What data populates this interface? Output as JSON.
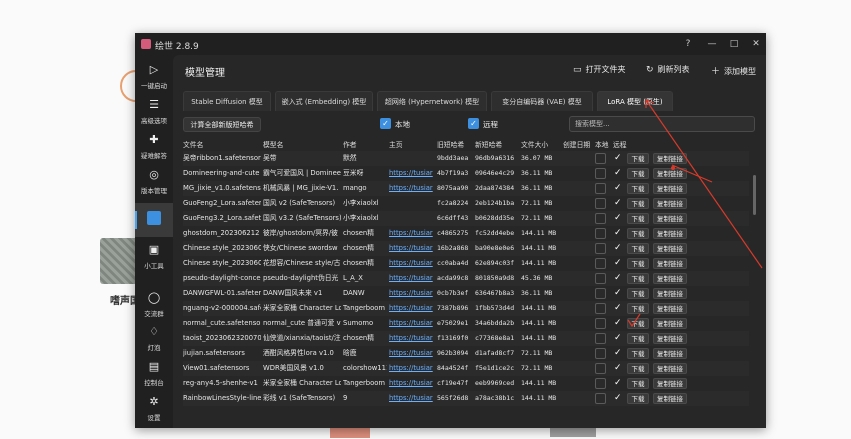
{
  "app": {
    "title": "绘世 2.8.9",
    "help": "?",
    "minimize": "—",
    "maximize": "□",
    "close": "✕"
  },
  "sidebar": [
    {
      "label": "一键启动",
      "icon": "play-icon",
      "glyph": "▷"
    },
    {
      "label": "高级选项",
      "icon": "list-icon",
      "glyph": "☰"
    },
    {
      "label": "疑难解答",
      "icon": "diagnose-icon",
      "glyph": "✚"
    },
    {
      "label": "版本管理",
      "icon": "version-icon",
      "glyph": "◎"
    },
    {
      "label": "",
      "icon": "model-cube-icon",
      "glyph": ""
    },
    {
      "label": "小工具",
      "icon": "toolbox-icon",
      "glyph": "▣"
    },
    {
      "label": "交流群",
      "icon": "chat-icon",
      "glyph": "◯"
    },
    {
      "label": "灯泡",
      "icon": "bulb-icon",
      "glyph": "♢"
    },
    {
      "label": "控制台",
      "icon": "console-icon",
      "glyph": "▤"
    },
    {
      "label": "设置",
      "icon": "settings-icon",
      "glyph": "✲"
    }
  ],
  "header": {
    "title": "模型管理",
    "open_folder": "打开文件夹",
    "refresh": "刷新列表",
    "add_model": "添加模型"
  },
  "tabs": [
    "Stable Diffusion 模型",
    "嵌入式 (Embedding) 模型",
    "超网络 (Hypernetwork) 模型",
    "变分自编码器 (VAE) 模型",
    "LoRA 模型 (原生)"
  ],
  "toolbar": {
    "calc_hash": "计算全部新版短哈希",
    "local": "本地",
    "remote": "远程",
    "search_placeholder": "搜索模型..."
  },
  "table": {
    "headers": [
      "文件名",
      "模型名",
      "作者",
      "主页",
      "旧短哈希",
      "新短哈希",
      "文件大小",
      "创建日期",
      "本地",
      "远程"
    ],
    "download": "下载",
    "copy_link": "复制链接",
    "rows": [
      {
        "file": "吴帝ribbon1.safetensor",
        "model": "吴带",
        "author": "默然",
        "home": "",
        "old": "9bdd3aea",
        "new": "96db9a6316",
        "size": "36.07 MB",
        "local": false,
        "remote": true
      },
      {
        "file": "Domineering-and-cute",
        "model": "霸气可爱国风 | Dominee",
        "author": "豆米呀",
        "home": "https://tusiar",
        "old": "4b7f19a3",
        "new": "09646e4c29",
        "size": "36.11 MB",
        "local": false,
        "remote": true
      },
      {
        "file": "MG_jixie_v1.0.safetens",
        "model": "机械风暴 | MG_jixie-V1.",
        "author": "mango",
        "home": "https://tusiar",
        "old": "8075aa90",
        "new": "2daa874384",
        "size": "36.11 MB",
        "local": false,
        "remote": true
      },
      {
        "file": "GuoFeng2_Lora.safeter",
        "model": "国风 v2 (SafeTensors)",
        "author": "小李xiaolxl",
        "home": "",
        "old": "fc2a8224",
        "new": "2eb124b1ba",
        "size": "72.11 MB",
        "local": false,
        "remote": true
      },
      {
        "file": "GuoFeng3.2_Lora.safet",
        "model": "国风 v3.2 (SafeTensors)",
        "author": "小李xiaolxl",
        "home": "",
        "old": "6c6dff43",
        "new": "b0628dd35e",
        "size": "72.11 MB",
        "local": false,
        "remote": true
      },
      {
        "file": "ghostdom_202306212",
        "model": "彼岸/ghostdom/冥界/彼",
        "author": "chosen精",
        "home": "https://tusiar",
        "old": "c4865275",
        "new": "fc52dd4ebe",
        "size": "144.11 MB",
        "local": false,
        "remote": true
      },
      {
        "file": "Chinese style_2023060",
        "model": "侠女/Chinese swordsw",
        "author": "chosen精",
        "home": "https://tusiar",
        "old": "16b2a868",
        "new": "ba90e8e0e6",
        "size": "144.11 MB",
        "local": false,
        "remote": true
      },
      {
        "file": "Chinese style_2023060",
        "model": "花想容/Chinese style/古",
        "author": "chosen精",
        "home": "https://tusiar",
        "old": "cc0aba4d",
        "new": "62e894c03f",
        "size": "144.11 MB",
        "local": false,
        "remote": true
      },
      {
        "file": "pseudo-daylight-conce",
        "model": "pseudo-daylight伪日光",
        "author": "L_A_X",
        "home": "https://tusiar",
        "old": "acda99c8",
        "new": "801850a9d8",
        "size": "45.36 MB",
        "local": false,
        "remote": true
      },
      {
        "file": "DANWGFWL-01.safeter",
        "model": "DANW国风未来 v1",
        "author": "DANW",
        "home": "https://tusiar",
        "old": "0cb7b3ef",
        "new": "636467b8a3",
        "size": "36.11 MB",
        "local": false,
        "remote": true
      },
      {
        "file": "nguang-v2-000004.safe",
        "model": "米家全家桶 Character Lo",
        "author": "Tangerboom",
        "home": "https://tusiar",
        "old": "7387b896",
        "new": "1fbb573d4d",
        "size": "144.11 MB",
        "local": false,
        "remote": true
      },
      {
        "file": "normal_cute.safetensor",
        "model": "normal_cute 普通可爱 v",
        "author": "Sumomo",
        "home": "https://tusiar",
        "old": "e75029e1",
        "new": "34a6bdda2b",
        "size": "144.11 MB",
        "local": false,
        "remote": true
      },
      {
        "file": "taoist_20230623200708",
        "model": "仙侠道/xianxia/taoist/注",
        "author": "chosen精",
        "home": "https://tusiar",
        "old": "f13169f0",
        "new": "c77368e8a1",
        "size": "144.11 MB",
        "local": false,
        "remote": true
      },
      {
        "file": "jiujian.safetensors",
        "model": "酒酣风格男性lora v1.0",
        "author": "晗鹿",
        "home": "https://tusiar",
        "old": "962b3094",
        "new": "d1afad8cf7",
        "size": "72.11 MB",
        "local": false,
        "remote": true
      },
      {
        "file": "View01.safetensors",
        "model": "WDR美国风景 v1.0",
        "author": "colorshow111",
        "home": "https://tusiar",
        "old": "84a4524f",
        "new": "f5e1d1ce2c",
        "size": "72.11 MB",
        "local": false,
        "remote": true
      },
      {
        "file": "reg-any4.5-shenhe-v1",
        "model": "米家全家桶 Character Lo",
        "author": "Tangerboom",
        "home": "https://tusiar",
        "old": "cf19e47f",
        "new": "eeb9969ced",
        "size": "144.11 MB",
        "local": false,
        "remote": true
      },
      {
        "file": "RainbowLinesStyle-line",
        "model": "彩线 v1 (SafeTensors)",
        "author": "9",
        "home": "https://tusiar",
        "old": "565f26d8",
        "new": "a78ac38b1c",
        "size": "144.11 MB",
        "local": false,
        "remote": true
      }
    ]
  },
  "background": {
    "thumb_label": "嗜声国"
  },
  "colors": {
    "accent": "#3d8fe0",
    "annotation": "#d83a2a",
    "link": "#6ab0ff"
  }
}
